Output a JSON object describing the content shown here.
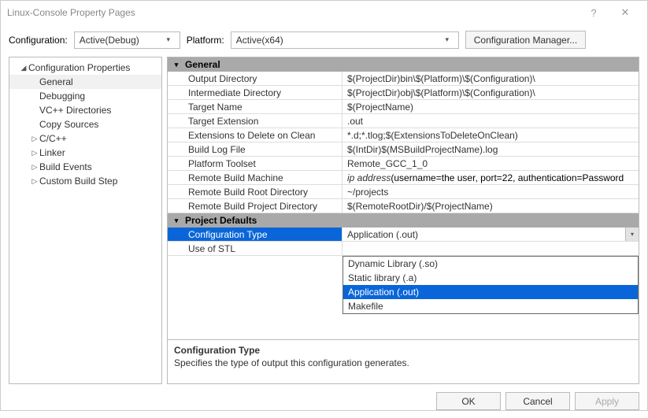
{
  "window": {
    "title": "Linux-Console Property Pages"
  },
  "toolbar": {
    "config_label": "Configuration:",
    "config_value": "Active(Debug)",
    "platform_label": "Platform:",
    "platform_value": "Active(x64)",
    "config_manager": "Configuration Manager..."
  },
  "tree": {
    "root": "Configuration Properties",
    "items": [
      {
        "label": "General",
        "selected": true
      },
      {
        "label": "Debugging"
      },
      {
        "label": "VC++ Directories"
      },
      {
        "label": "Copy Sources"
      },
      {
        "label": "C/C++",
        "expandable": true
      },
      {
        "label": "Linker",
        "expandable": true
      },
      {
        "label": "Build Events",
        "expandable": true
      },
      {
        "label": "Custom Build Step",
        "expandable": true
      }
    ]
  },
  "sections": {
    "general": "General",
    "defaults": "Project Defaults"
  },
  "general_rows": [
    {
      "name": "Output Directory",
      "value": "$(ProjectDir)bin\\$(Platform)\\$(Configuration)\\"
    },
    {
      "name": "Intermediate Directory",
      "value": "$(ProjectDir)obj\\$(Platform)\\$(Configuration)\\"
    },
    {
      "name": "Target Name",
      "value": "$(ProjectName)"
    },
    {
      "name": "Target Extension",
      "value": ".out"
    },
    {
      "name": "Extensions to Delete on Clean",
      "value": "*.d;*.tlog;$(ExtensionsToDeleteOnClean)"
    },
    {
      "name": "Build Log File",
      "value": "$(IntDir)$(MSBuildProjectName).log"
    },
    {
      "name": "Platform Toolset",
      "value": "Remote_GCC_1_0"
    },
    {
      "name": "Remote Build Machine",
      "value_ip": "ip address",
      "value_rest": "    (username=the user, port=22, authentication=Password"
    },
    {
      "name": "Remote Build Root Directory",
      "value": "~/projects"
    },
    {
      "name": "Remote Build Project Directory",
      "value": "$(RemoteRootDir)/$(ProjectName)"
    }
  ],
  "defaults_rows": [
    {
      "name": "Configuration Type",
      "value": "Application (.out)",
      "selected": true
    },
    {
      "name": "Use of STL",
      "value": ""
    }
  ],
  "dropdown_options": [
    {
      "label": "Dynamic Library (.so)"
    },
    {
      "label": "Static library (.a)"
    },
    {
      "label": "Application (.out)",
      "highlighted": true
    },
    {
      "label": "Makefile"
    }
  ],
  "description": {
    "title": "Configuration Type",
    "body": "Specifies the type of output this configuration generates."
  },
  "footer": {
    "ok": "OK",
    "cancel": "Cancel",
    "apply": "Apply"
  }
}
